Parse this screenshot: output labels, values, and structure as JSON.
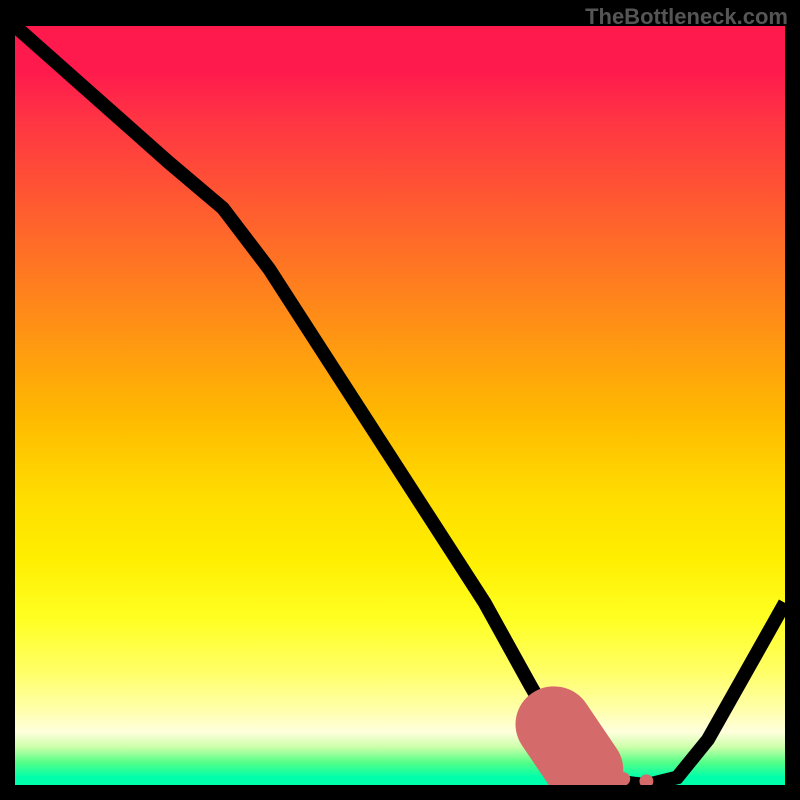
{
  "watermark": "TheBottleneck.com",
  "chart_data": {
    "type": "line",
    "title": "",
    "xlabel": "",
    "ylabel": "",
    "xlim": [
      0,
      100
    ],
    "ylim": [
      0,
      100
    ],
    "grid": false,
    "curve": [
      {
        "x": 0,
        "y": 100
      },
      {
        "x": 10,
        "y": 91
      },
      {
        "x": 20,
        "y": 82
      },
      {
        "x": 27,
        "y": 76
      },
      {
        "x": 33,
        "y": 68
      },
      {
        "x": 40,
        "y": 57
      },
      {
        "x": 47,
        "y": 46
      },
      {
        "x": 54,
        "y": 35
      },
      {
        "x": 61,
        "y": 24
      },
      {
        "x": 67,
        "y": 13
      },
      {
        "x": 71,
        "y": 6
      },
      {
        "x": 74,
        "y": 2
      },
      {
        "x": 78,
        "y": 0.5
      },
      {
        "x": 82,
        "y": 0
      },
      {
        "x": 86,
        "y": 1
      },
      {
        "x": 90,
        "y": 6
      },
      {
        "x": 95,
        "y": 15
      },
      {
        "x": 100,
        "y": 24
      }
    ],
    "highlight_segment": {
      "x_start": 70,
      "x_end": 74,
      "y_start": 8,
      "y_end": 2
    },
    "highlight_dots": [
      {
        "x": 75,
        "y": 1.5
      },
      {
        "x": 77,
        "y": 1
      },
      {
        "x": 79,
        "y": 0.8
      },
      {
        "x": 82,
        "y": 0.5
      }
    ]
  }
}
